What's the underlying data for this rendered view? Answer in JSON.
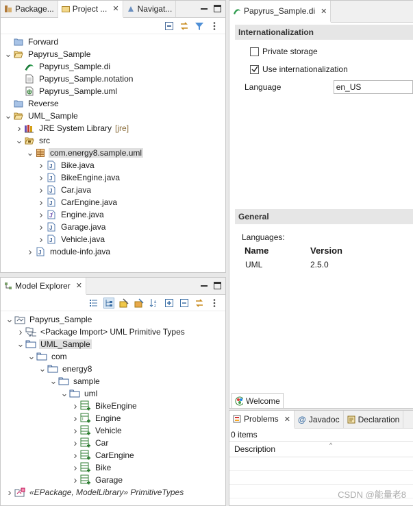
{
  "project_tabs": [
    {
      "label": "Package..."
    },
    {
      "label": "Project ..."
    },
    {
      "label": "Navigat..."
    }
  ],
  "project_tree": [
    {
      "label": "Forward",
      "icon": "folder-icon",
      "indent": 0,
      "twisty": ""
    },
    {
      "label": "Papyrus_Sample",
      "icon": "open-project-icon",
      "indent": 0,
      "twisty": "v"
    },
    {
      "label": "Papyrus_Sample.di",
      "icon": "papyrus-di-icon",
      "indent": 1,
      "twisty": ""
    },
    {
      "label": "Papyrus_Sample.notation",
      "icon": "file-icon",
      "indent": 1,
      "twisty": ""
    },
    {
      "label": "Papyrus_Sample.uml",
      "icon": "uml-file-icon",
      "indent": 1,
      "twisty": ""
    },
    {
      "label": "Reverse",
      "icon": "folder-icon",
      "indent": 0,
      "twisty": ""
    },
    {
      "label": "UML_Sample",
      "icon": "open-project-icon",
      "indent": 0,
      "twisty": "v"
    },
    {
      "label": "JRE System Library",
      "suffix": "[jre]",
      "icon": "library-icon",
      "indent": 1,
      "twisty": ">"
    },
    {
      "label": "src",
      "icon": "source-folder-icon",
      "indent": 1,
      "twisty": "v"
    },
    {
      "label": "com.energy8.sample.uml",
      "icon": "package-icon",
      "indent": 2,
      "twisty": "v",
      "highlight": true
    },
    {
      "label": "Bike.java",
      "icon": "java-file-icon",
      "indent": 3,
      "twisty": ">"
    },
    {
      "label": "BikeEngine.java",
      "icon": "java-file-icon",
      "indent": 3,
      "twisty": ">"
    },
    {
      "label": "Car.java",
      "icon": "java-file-icon",
      "indent": 3,
      "twisty": ">"
    },
    {
      "label": "CarEngine.java",
      "icon": "java-file-icon",
      "indent": 3,
      "twisty": ">"
    },
    {
      "label": "Engine.java",
      "icon": "java-interface-file-icon",
      "indent": 3,
      "twisty": ">"
    },
    {
      "label": "Garage.java",
      "icon": "java-file-icon",
      "indent": 3,
      "twisty": ">"
    },
    {
      "label": "Vehicle.java",
      "icon": "java-file-icon",
      "indent": 3,
      "twisty": ">"
    },
    {
      "label": "module-info.java",
      "icon": "java-file-icon",
      "indent": 2,
      "twisty": ">"
    }
  ],
  "model_explorer": {
    "tab_label": "Model Explorer",
    "tree": [
      {
        "label": "Papyrus_Sample",
        "icon": "model-icon",
        "indent": 0,
        "twisty": "v"
      },
      {
        "label": "<Package Import> UML Primitive Types",
        "icon": "package-import-icon",
        "indent": 1,
        "twisty": ">"
      },
      {
        "label": "UML_Sample",
        "icon": "uml-package-icon",
        "indent": 1,
        "twisty": "v",
        "highlight": true
      },
      {
        "label": "com",
        "icon": "uml-package-icon",
        "indent": 2,
        "twisty": "v"
      },
      {
        "label": "energy8",
        "icon": "uml-package-icon",
        "indent": 3,
        "twisty": "v"
      },
      {
        "label": "sample",
        "icon": "uml-package-icon",
        "indent": 4,
        "twisty": "v"
      },
      {
        "label": "uml",
        "icon": "uml-package-icon",
        "indent": 5,
        "twisty": "v"
      },
      {
        "label": "BikeEngine",
        "icon": "uml-class-icon",
        "indent": 6,
        "twisty": ">"
      },
      {
        "label": "Engine",
        "icon": "uml-interface-icon",
        "indent": 6,
        "twisty": ">"
      },
      {
        "label": "Vehicle",
        "icon": "uml-class-icon",
        "indent": 6,
        "twisty": ">"
      },
      {
        "label": "Car",
        "icon": "uml-class-icon",
        "indent": 6,
        "twisty": ">"
      },
      {
        "label": "CarEngine",
        "icon": "uml-class-icon",
        "indent": 6,
        "twisty": ">"
      },
      {
        "label": "Bike",
        "icon": "uml-class-icon",
        "indent": 6,
        "twisty": ">"
      },
      {
        "label": "Garage",
        "icon": "uml-class-icon",
        "indent": 6,
        "twisty": ">"
      },
      {
        "label": "«EPackage, ModelLibrary» PrimitiveTypes",
        "icon": "profile-package-icon",
        "indent": 0,
        "twisty": ">",
        "italic": true
      }
    ]
  },
  "editor": {
    "tab_label": "Papyrus_Sample.di",
    "internationalization": {
      "header": "Internationalization",
      "private_storage_label": "Private storage",
      "private_storage_checked": false,
      "use_i18n_label": "Use internationalization",
      "use_i18n_checked": true,
      "language_label": "Language",
      "language_value": "en_US"
    },
    "general": {
      "header": "General",
      "languages_label": "Languages:",
      "col_name": "Name",
      "col_version": "Version",
      "rows": [
        {
          "name": "UML",
          "version": "2.5.0"
        }
      ]
    },
    "welcome_tab": "Welcome"
  },
  "bottom_panel": {
    "tabs": [
      {
        "label": "Problems",
        "close": true
      },
      {
        "label": "Javadoc"
      },
      {
        "label": "Declaration"
      }
    ],
    "count": "0 items",
    "col_description": "Description"
  },
  "watermark": "CSDN @能量老8"
}
